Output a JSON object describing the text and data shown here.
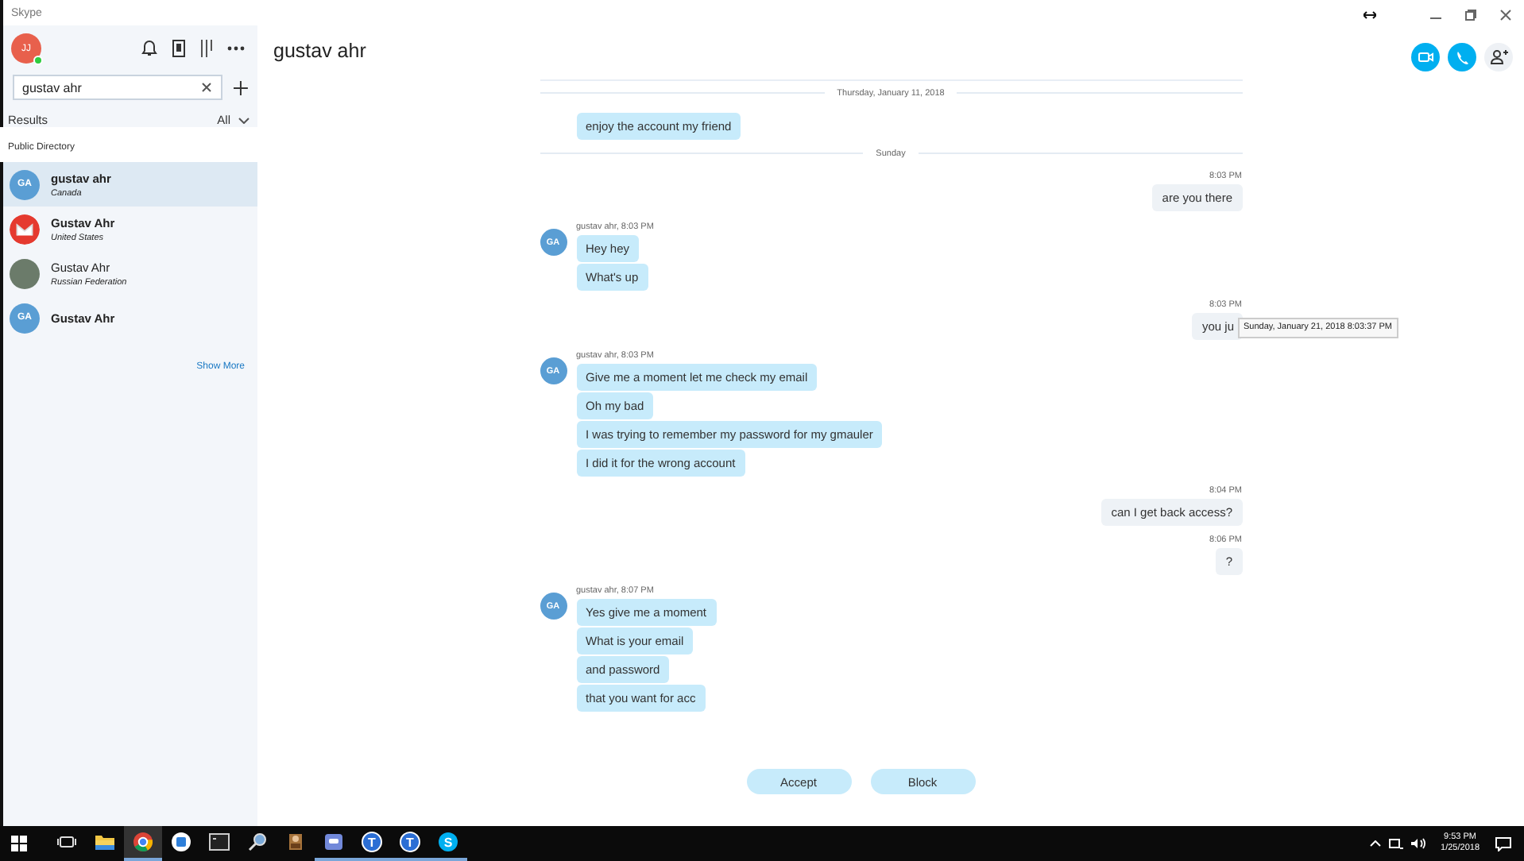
{
  "app": {
    "title": "Skype"
  },
  "profile": {
    "initials": "JJ",
    "online": true
  },
  "search": {
    "value": "gustav ahr"
  },
  "results": {
    "label": "Results",
    "filter": "All"
  },
  "section": "Public Directory",
  "contacts": [
    {
      "kind": "initials",
      "initials": "GA",
      "name": "gustav ahr",
      "location": "Canada",
      "bold": true,
      "selected": true
    },
    {
      "kind": "logo",
      "name": "Gustav Ahr",
      "location": "United States",
      "bold": true,
      "selected": false
    },
    {
      "kind": "photo",
      "name": "Gustav Ahr",
      "location": "Russian Federation",
      "bold": false,
      "selected": false
    },
    {
      "kind": "initials",
      "initials": "GA",
      "name": "Gustav Ahr",
      "bold": true,
      "selected": false
    }
  ],
  "show_more": "Show More",
  "conversation": {
    "title": "gustav ahr"
  },
  "messages": [
    {
      "kind": "divider",
      "text": "Thursday, January 11, 2018"
    },
    {
      "kind": "incoming",
      "bubbles": [
        "enjoy the account my friend"
      ]
    },
    {
      "kind": "divider",
      "text": "Sunday"
    },
    {
      "kind": "outgoing",
      "time": "8:03 PM",
      "bubbles": [
        "are you there"
      ]
    },
    {
      "kind": "incoming",
      "initials": "GA",
      "header": "gustav ahr, 8:03 PM",
      "bubbles": [
        "Hey hey",
        "What's up"
      ]
    },
    {
      "kind": "outgoing",
      "time": "8:03 PM",
      "bubbles": [
        "you ju"
      ],
      "tooltip": "Sunday, January 21, 2018 8:03:37 PM"
    },
    {
      "kind": "incoming",
      "initials": "GA",
      "header": "gustav ahr, 8:03 PM",
      "bubbles": [
        "Give me a moment let me check my email",
        "Oh my bad",
        "I was trying to remember my password for my gmauler",
        "I did it for the wrong account"
      ]
    },
    {
      "kind": "outgoing",
      "time": "8:04 PM",
      "bubbles": [
        "can I get back access?"
      ]
    },
    {
      "kind": "outgoing",
      "time": "8:06 PM",
      "bubbles": [
        "?"
      ]
    },
    {
      "kind": "incoming",
      "initials": "GA",
      "header": "gustav ahr, 8:07 PM",
      "bubbles": [
        "Yes give me a moment",
        "What is your email",
        "and password",
        "that you want for acc"
      ]
    }
  ],
  "actions": [
    "Accept",
    "Block"
  ],
  "taskbar": {
    "apps": [
      {
        "kind": "taskview",
        "running": false,
        "selected": false
      },
      {
        "kind": "folder",
        "running": false,
        "selected": false
      },
      {
        "kind": "chrome",
        "running": true,
        "selected": true
      },
      {
        "kind": "bluebox",
        "running": false,
        "selected": false
      },
      {
        "kind": "terminal",
        "running": false,
        "selected": false
      },
      {
        "kind": "magnifier",
        "running": false,
        "selected": false
      },
      {
        "kind": "character",
        "running": false,
        "selected": false
      },
      {
        "kind": "chat",
        "running": true,
        "selected": false
      },
      {
        "kind": "letter",
        "letter": "T",
        "running": true,
        "selected": false
      },
      {
        "kind": "letter",
        "letter": "T",
        "running": true,
        "selected": false
      },
      {
        "kind": "skype",
        "letter": "S",
        "running": true,
        "selected": false
      }
    ],
    "time": "9:53 PM",
    "date": "1/25/2018"
  }
}
